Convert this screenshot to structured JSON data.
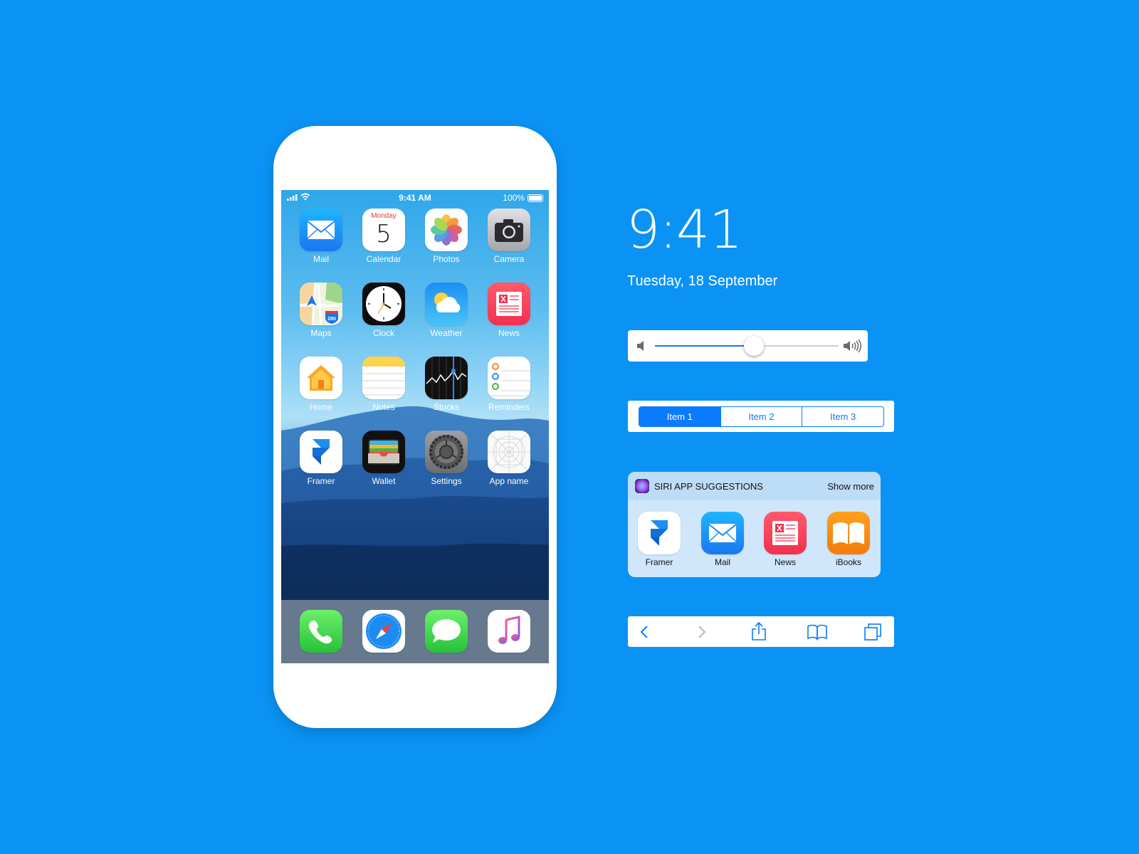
{
  "status_bar": {
    "time": "9:41 AM",
    "battery": "100%"
  },
  "home_apps": [
    {
      "label": "Mail",
      "icon": "mail-icon"
    },
    {
      "label": "Calendar",
      "icon": "calendar-icon",
      "day": "Monday",
      "date": "5"
    },
    {
      "label": "Photos",
      "icon": "photos-icon"
    },
    {
      "label": "Camera",
      "icon": "camera-icon"
    },
    {
      "label": "Maps",
      "icon": "maps-icon",
      "badge": "280"
    },
    {
      "label": "Clock",
      "icon": "clock-icon"
    },
    {
      "label": "Weather",
      "icon": "weather-icon"
    },
    {
      "label": "News",
      "icon": "news-icon"
    },
    {
      "label": "Home",
      "icon": "home-icon"
    },
    {
      "label": "Notes",
      "icon": "notes-icon"
    },
    {
      "label": "Stocks",
      "icon": "stocks-icon"
    },
    {
      "label": "Reminders",
      "icon": "reminders-icon"
    },
    {
      "label": "Framer",
      "icon": "framer-icon"
    },
    {
      "label": "Wallet",
      "icon": "wallet-icon"
    },
    {
      "label": "Settings",
      "icon": "settings-icon"
    },
    {
      "label": "App name",
      "icon": "app-template-icon"
    }
  ],
  "dock_apps": [
    {
      "icon": "phone-icon"
    },
    {
      "icon": "safari-icon"
    },
    {
      "icon": "messages-icon"
    },
    {
      "icon": "music-icon"
    }
  ],
  "lock": {
    "time": "9:41",
    "date": "Tuesday, 18 September"
  },
  "volume": {
    "level": 0.54
  },
  "segmented": {
    "items": [
      "Item 1",
      "Item 2",
      "Item 3"
    ],
    "active_index": 0
  },
  "siri": {
    "title": "SIRI APP SUGGESTIONS",
    "more": "Show more",
    "apps": [
      {
        "label": "Framer",
        "icon": "framer-icon"
      },
      {
        "label": "Mail",
        "icon": "mail-icon"
      },
      {
        "label": "News",
        "icon": "news-icon"
      },
      {
        "label": "iBooks",
        "icon": "ibooks-icon"
      }
    ]
  },
  "toolbar": {
    "buttons": [
      "back-icon",
      "forward-icon",
      "share-icon",
      "bookmarks-icon",
      "tabs-icon"
    ]
  },
  "colors": {
    "background": "#0a93f5",
    "accent": "#0a7bff"
  }
}
